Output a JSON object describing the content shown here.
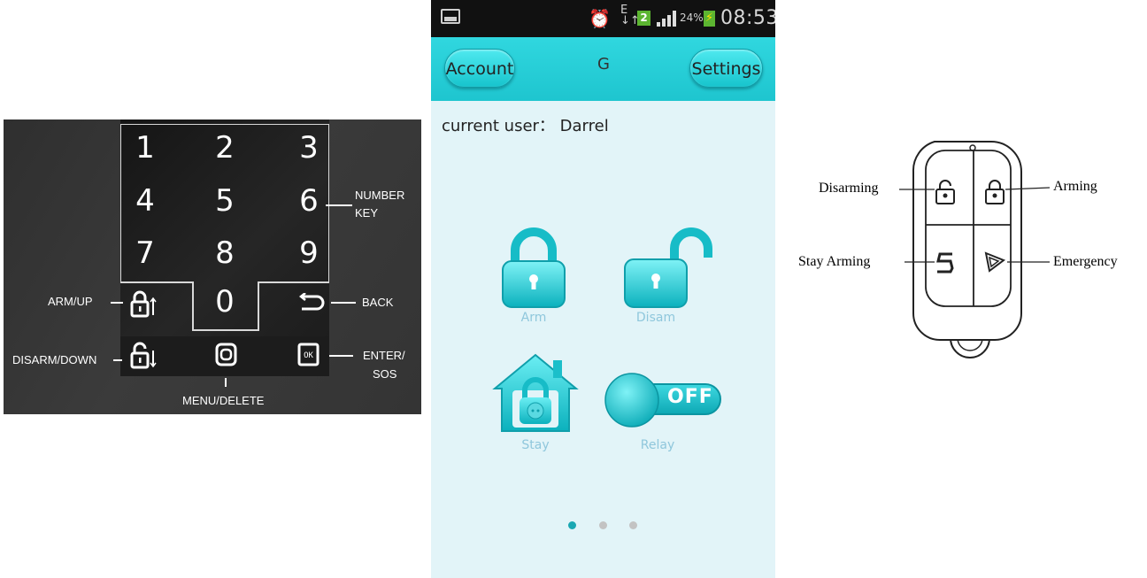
{
  "keypad": {
    "digits": [
      "1",
      "2",
      "3",
      "4",
      "5",
      "6",
      "7",
      "8",
      "9",
      "0"
    ],
    "labels": {
      "number_key_line1": "NUMBER",
      "number_key_line2": "KEY",
      "arm_up": "ARM/UP",
      "back": "BACK",
      "disarm_down": "DISARM/DOWN",
      "enter_sos_line1": "ENTER/",
      "enter_sos_line2": "SOS",
      "menu_delete": "MENU/DELETE"
    },
    "icons": {
      "arm": "lock-closed-up-icon",
      "back": "back-arrow-icon",
      "disarm": "lock-open-down-icon",
      "menu": "menu-square-icon",
      "enter": "ok-key-icon"
    }
  },
  "phone": {
    "status_bar": {
      "sim_number": "2",
      "battery_percent": "24%",
      "time": "08:53"
    },
    "header": {
      "account_label": "Account",
      "title": "G",
      "settings_label": "Settings"
    },
    "current_user": "current user： Darrel",
    "actions": {
      "arm_label": "Arm",
      "disarm_label": "Disam",
      "stay_label": "Stay",
      "relay_label": "Relay",
      "relay_toggle_text": "OFF"
    },
    "pager": {
      "pages": 3,
      "active": 1
    },
    "colors": {
      "header": "#1ec5cf",
      "background": "#e2f4f8",
      "dot_active": "#1aa7b2",
      "dot_inactive": "#c3c3c3"
    }
  },
  "remote": {
    "labels": {
      "disarming": "Disarming",
      "arming": "Arming",
      "stay_arming": "Stay Arming",
      "emergency": "Emergency"
    }
  }
}
